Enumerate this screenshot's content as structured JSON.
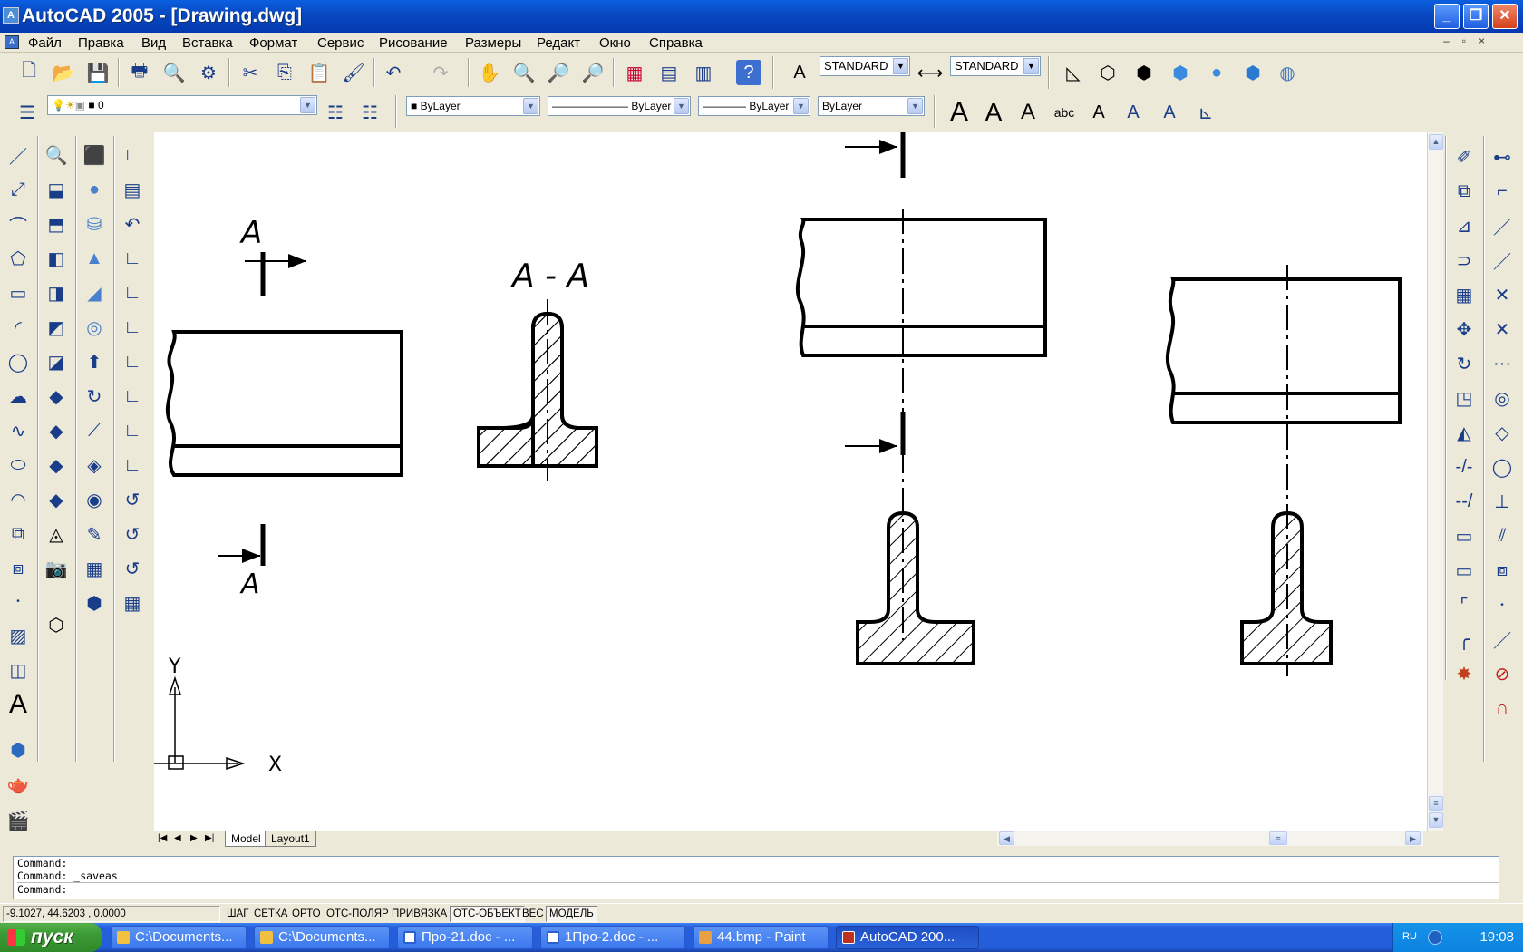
{
  "window": {
    "title": "AutoCAD 2005 - [Drawing.dwg]",
    "minimize": "_",
    "maximize": "❐",
    "close": "✕"
  },
  "menu": [
    "Файл",
    "Правка",
    "Вид",
    "Вставка",
    "Формат",
    "Сервис",
    "Рисование",
    "Размеры",
    "Редакт",
    "Окно",
    "Справка"
  ],
  "toolbar": {
    "text_style": "STANDARD",
    "dim_style": "STANDARD",
    "layer": "0",
    "color": "ByLayer",
    "linetype": "ByLayer",
    "lineweight": "ByLayer",
    "plotstyle": "ByLayer"
  },
  "drawing": {
    "section_label_top": "A",
    "section_label_bottom": "A",
    "section_title": "A - A",
    "ucs_x": "X",
    "ucs_y": "Y"
  },
  "tabs": {
    "model": "Model",
    "layout": "Layout1"
  },
  "command_lines": [
    "Command:",
    "Command: _saveas",
    "Command:"
  ],
  "status": {
    "coords": "-9.1027, 44.6203 , 0.0000",
    "buttons": [
      {
        "label": "ШАГ",
        "on": false
      },
      {
        "label": "СЕТКА",
        "on": false
      },
      {
        "label": "ОРТО",
        "on": false
      },
      {
        "label": "ОТС-ПОЛЯР",
        "on": false
      },
      {
        "label": "ПРИВЯЗКА",
        "on": false
      },
      {
        "label": "ОТС-ОБЪЕКТ",
        "on": true
      },
      {
        "label": "ВЕС",
        "on": false
      },
      {
        "label": "МОДЕЛЬ",
        "on": true
      }
    ]
  },
  "taskbar": {
    "start": "пуск",
    "tasks": [
      {
        "label": "C:\\Documents...",
        "color": "#f0c040"
      },
      {
        "label": "C:\\Documents...",
        "color": "#f0c040"
      },
      {
        "label": "Про-21.doc - ...",
        "color": "#2b5fd0"
      },
      {
        "label": "1Про-2.doc - ...",
        "color": "#2b5fd0"
      },
      {
        "label": "44.bmp - Paint",
        "color": "#e8a040"
      },
      {
        "label": "AutoCAD 200...",
        "color": "#c03020"
      }
    ],
    "lang": "RU",
    "clock": "19:08"
  }
}
